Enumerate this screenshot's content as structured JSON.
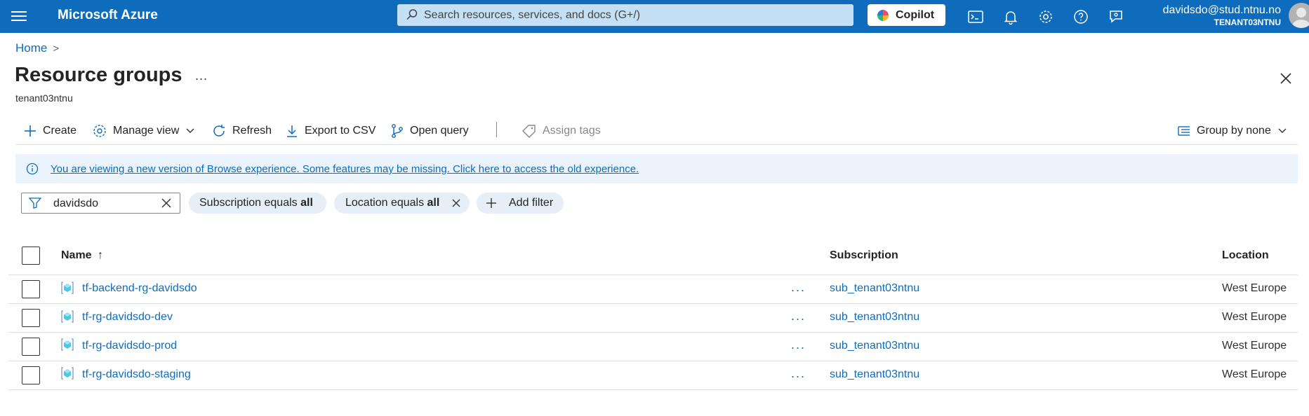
{
  "topbar": {
    "brand": "Microsoft Azure",
    "search_placeholder": "Search resources, services, and docs (G+/)",
    "copilot_label": "Copilot",
    "user_email": "davidsdo@stud.ntnu.no",
    "user_tenant": "TENANT03NTNU"
  },
  "breadcrumb": {
    "home": "Home"
  },
  "page": {
    "title": "Resource groups",
    "more": "...",
    "subtitle": "tenant03ntnu"
  },
  "commands": {
    "create": "Create",
    "manage_view": "Manage view",
    "refresh": "Refresh",
    "export_csv": "Export to CSV",
    "open_query": "Open query",
    "assign_tags": "Assign tags",
    "group_by": "Group by none"
  },
  "banner": {
    "message": "You are viewing a new version of Browse experience. Some features may be missing. Click here to access the old experience."
  },
  "filters": {
    "search_value": "davidsdo",
    "subscription_prefix": "Subscription equals ",
    "subscription_value": "all",
    "location_prefix": "Location equals ",
    "location_value": "all",
    "add_filter": "Add filter"
  },
  "table": {
    "headers": {
      "name": "Name",
      "name_sort": "↑",
      "subscription": "Subscription",
      "location": "Location"
    },
    "rows": [
      {
        "name": "tf-backend-rg-davidsdo",
        "more": "...",
        "subscription": "sub_tenant03ntnu",
        "location": "West Europe"
      },
      {
        "name": "tf-rg-davidsdo-dev",
        "more": "...",
        "subscription": "sub_tenant03ntnu",
        "location": "West Europe"
      },
      {
        "name": "tf-rg-davidsdo-prod",
        "more": "...",
        "subscription": "sub_tenant03ntnu",
        "location": "West Europe"
      },
      {
        "name": "tf-rg-davidsdo-staging",
        "more": "...",
        "subscription": "sub_tenant03ntnu",
        "location": "West Europe"
      }
    ]
  },
  "colors": {
    "brand": "#0f6cbd",
    "banner": "#ebf3fc",
    "pill": "#e6eef7"
  },
  "icons": [
    "menu-icon",
    "search-icon",
    "copilot-icon",
    "cloud-shell-icon",
    "bell-icon",
    "gear-icon",
    "help-icon",
    "feedback-icon",
    "avatar-icon",
    "close-icon",
    "plus-icon",
    "manage-view-icon",
    "chevron-down-icon",
    "refresh-icon",
    "download-icon",
    "query-icon",
    "tag-icon",
    "group-by-icon",
    "info-icon",
    "filter-icon",
    "resource-group-icon"
  ]
}
